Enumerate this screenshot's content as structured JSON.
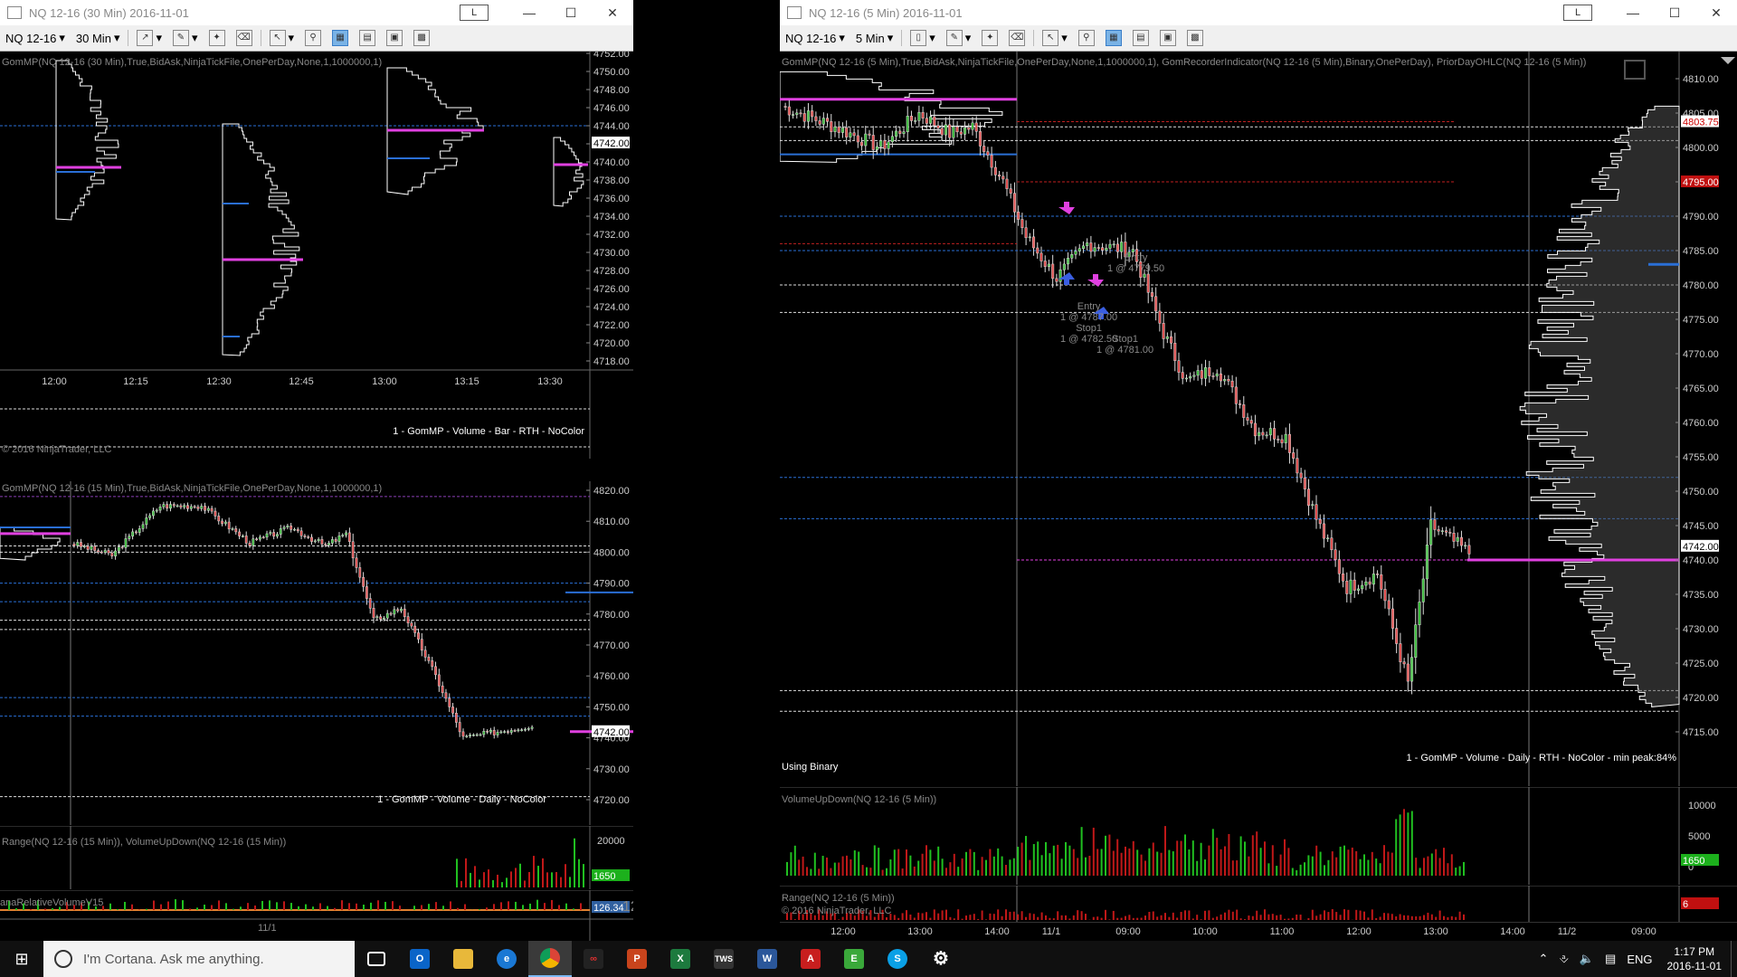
{
  "left_window": {
    "title": "NQ 12-16 (30 Min)  2016-11-01",
    "l_button": "L",
    "toolbar": {
      "instrument": "NQ 12-16",
      "interval": "30 Min"
    },
    "top_pane": {
      "indicator": "GomMP(NQ 12-16 (30 Min),True,BidAsk,NinjaTickFile,OnePerDay,None,1,1000000,1)",
      "footer": "1 - GomMP - Volume - Bar - RTH - NoColor",
      "copyright": "© 2016 NinjaTrader, LLC",
      "price_axis": [
        "4752.00",
        "4750.00",
        "4748.00",
        "4746.00",
        "4744.00",
        "4742.00",
        "4740.00",
        "4738.00",
        "4736.00",
        "4734.00",
        "4732.00",
        "4730.00",
        "4728.00",
        "4726.00",
        "4724.00",
        "4722.00",
        "4720.00",
        "4718.00"
      ],
      "current_price": "4742.00",
      "time_axis": [
        "12:00",
        "12:15",
        "12:30",
        "12:45",
        "13:00",
        "13:15",
        "13:30"
      ]
    },
    "mid_pane": {
      "indicator": "GomMP(NQ 12-16 (15 Min),True,BidAsk,NinjaTickFile,OnePerDay,None,1,1000000,1)",
      "footer": "1 - GomMP - Volume - Daily - NoColor",
      "price_axis": [
        "4820.00",
        "4810.00",
        "4800.00",
        "4790.00",
        "4780.00",
        "4770.00",
        "4760.00",
        "4750.00",
        "4740.00",
        "4730.00",
        "4720.00"
      ],
      "current_price": "4742.00"
    },
    "vol_pane": {
      "label": "Range(NQ 12-16 (15 Min)), VolumeUpDown(NQ 12-16 (15 Min))",
      "axis_top": "20000",
      "current": "1650"
    },
    "rel_pane": {
      "label": "anaRelativeVolumeV15",
      "percent": "126%",
      "current": "126.34",
      "date_label": "11/1"
    }
  },
  "right_window": {
    "title": "NQ 12-16 (5 Min)  2016-11-01",
    "l_button": "L",
    "toolbar": {
      "instrument": "NQ 12-16",
      "interval": "5 Min"
    },
    "price_pane": {
      "indicator": "GomMP(NQ 12-16 (5 Min),True,BidAsk,NinjaTickFile,OnePerDay,None,1,1000000,1), GomRecorderIndicator(NQ 12-16 (5 Min),Binary,OnePerDay), PriorDayOHLC(NQ 12-16 (5 Min))",
      "footer": "1 - GomMP - Volume - Daily - RTH - NoColor - min peak:84%",
      "binary_label": "Using Binary",
      "price_axis": [
        "4810.00",
        "4805.00",
        "4800.00",
        "4795.00",
        "4790.00",
        "4785.00",
        "4780.00",
        "4775.00",
        "4770.00",
        "4765.00",
        "4760.00",
        "4755.00",
        "4750.00",
        "4745.00",
        "4740.00",
        "4735.00",
        "4730.00",
        "4725.00",
        "4720.00",
        "4715.00"
      ],
      "tag_high": "4803.75",
      "tag_prior": "4795.00",
      "current_price": "4742.00",
      "trades": [
        {
          "label": "Entry",
          "detail": "1 @ 4787.00"
        },
        {
          "label": "Stop1",
          "detail": "1 @ 4782.50"
        },
        {
          "label": "Entry",
          "detail": "1 @ 4779.50"
        },
        {
          "label": "Stop1",
          "detail": "1 @ 4781.00"
        }
      ]
    },
    "vol_pane": {
      "label": "VolumeUpDown(NQ 12-16 (5 Min))",
      "axis": [
        "10000",
        "5000",
        "0"
      ],
      "current": "1650"
    },
    "range_pane": {
      "label": "Range(NQ 12-16 (5 Min))",
      "copyright": "© 2016 NinjaTrader, LLC",
      "current": "6"
    },
    "time_axis": [
      "12:00",
      "13:00",
      "14:00",
      "11/1",
      "09:00",
      "10:00",
      "11:00",
      "12:00",
      "13:00",
      "14:00",
      "11/2",
      "09:00"
    ]
  },
  "taskbar": {
    "search_placeholder": "I'm Cortana. Ask me anything.",
    "apps": [
      "task-view",
      "outlook",
      "file-explorer",
      "edge",
      "chrome",
      "ninjatrader",
      "powerpoint",
      "excel",
      "tws",
      "word",
      "acrobat",
      "evernote",
      "skype",
      "settings"
    ],
    "language": "ENG",
    "time": "1:17 PM",
    "date": "2016-11-01"
  },
  "colors": {
    "candle_up": "#3dbd3d",
    "candle_down": "#e05050",
    "poc": "#e040e0",
    "hline_blue": "#2a6fd6",
    "prior_red": "#c02020",
    "volume_up": "#20c020",
    "volume_down": "#c01818"
  }
}
